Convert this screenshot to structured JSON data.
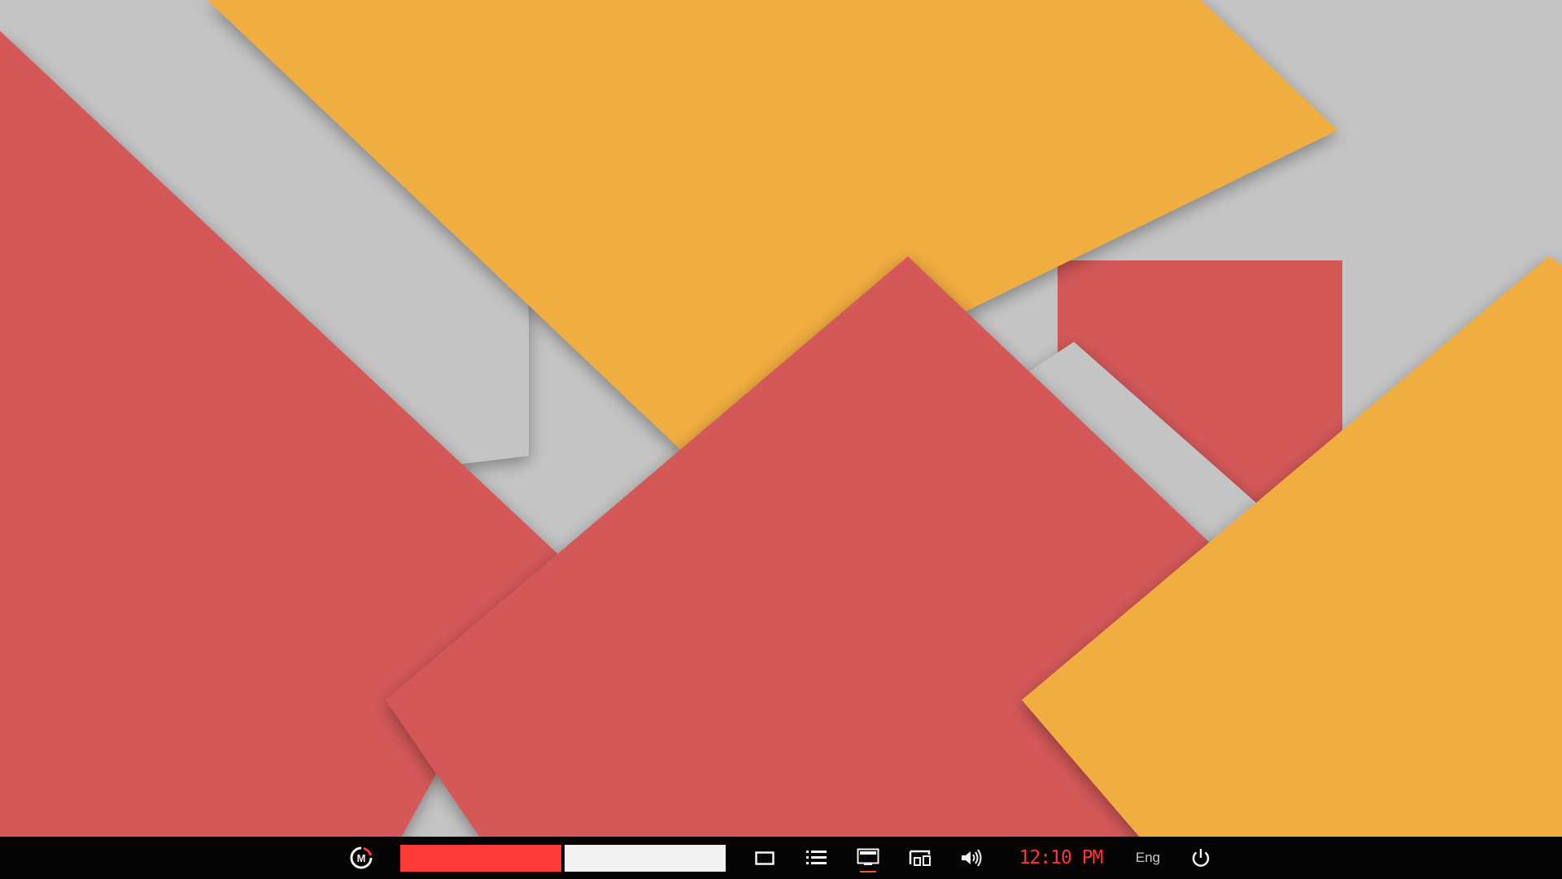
{
  "colors": {
    "wallpaper_gray": "#c4c4c4",
    "wallpaper_red": "#d45858",
    "wallpaper_orange": "#f0ad40",
    "taskbar_background": "#050505",
    "window_slot_active": "#ff3a3a",
    "window_slot_inactive": "#f2f2f2",
    "clock_text": "#ff3535",
    "display_indicator": "#e4641a"
  },
  "taskbar": {
    "start_icon": "m-logo-icon",
    "window_slots": [
      {
        "state": "active"
      },
      {
        "state": "inactive"
      }
    ],
    "tray_icons": [
      "show-desktop-icon",
      "task-list-icon",
      "display-icon",
      "devices-icon",
      "volume-icon"
    ],
    "clock": "12:10 PM",
    "language": "Eng",
    "power_icon": "power-icon"
  }
}
